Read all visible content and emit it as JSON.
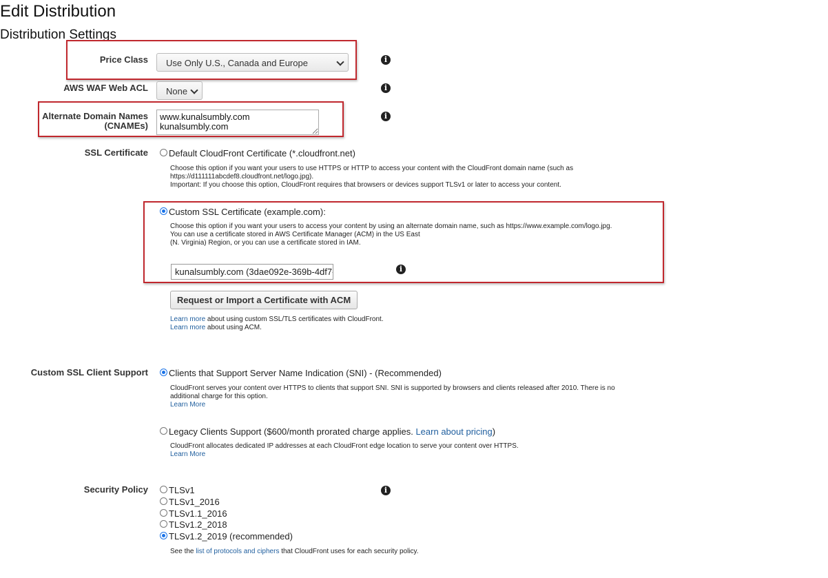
{
  "page": {
    "title": "Edit Distribution",
    "subtitle": "Distribution Settings"
  },
  "price_class": {
    "label": "Price Class",
    "value": "Use Only U.S., Canada and Europe"
  },
  "waf": {
    "label": "AWS WAF Web ACL",
    "value": "None"
  },
  "cnames": {
    "label_line1": "Alternate Domain Names",
    "label_line2": "(CNAMEs)",
    "value": "www.kunalsumbly.com\nkunalsumbly.com"
  },
  "ssl": {
    "label": "SSL Certificate",
    "default_option": "Default CloudFront Certificate (*.cloudfront.net)",
    "default_selected": false,
    "default_desc": [
      "Choose this option if you want your users to use HTTPS or HTTP to access your content with the CloudFront domain name (such as",
      "https://d111111abcdef8.cloudfront.net/logo.jpg).",
      "Important: If you choose this option, CloudFront requires that browsers or devices support TLSv1 or later to access your content."
    ],
    "custom_option": "Custom SSL Certificate (example.com):",
    "custom_selected": true,
    "custom_desc": [
      "Choose this option if you want your users to access your content by using an alternate domain name, such as https://www.example.com/logo.jpg.",
      "You can use a certificate stored in AWS Certificate Manager (ACM) in the US East",
      "(N. Virginia) Region, or you can use a certificate stored in IAM."
    ],
    "certificate_value": "kunalsumbly.com (3dae092e-369b-4df7-",
    "acm_button": "Request or Import a Certificate with ACM",
    "learn_more_1_link": "Learn more",
    "learn_more_1_text": " about using custom SSL/TLS certificates with CloudFront.",
    "learn_more_2_link": "Learn more",
    "learn_more_2_text": " about using ACM."
  },
  "client_support": {
    "label": "Custom SSL Client Support",
    "sni_option": "Clients that Support Server Name Indication (SNI) - (Recommended)",
    "sni_selected": true,
    "sni_desc": [
      "CloudFront serves your content over HTTPS to clients that support SNI. SNI is supported by browsers and clients released after 2010. There is no",
      "additional charge for this option."
    ],
    "sni_learn": "Learn More",
    "legacy_option": "Legacy Clients Support ($600/month prorated charge applies. ",
    "legacy_pricing_link": "Learn about pricing",
    "legacy_close": ")",
    "legacy_selected": false,
    "legacy_desc": "CloudFront allocates dedicated IP addresses at each CloudFront edge location to serve your content over HTTPS.",
    "legacy_learn": "Learn More"
  },
  "security_policy": {
    "label": "Security Policy",
    "options": [
      {
        "label": "TLSv1",
        "selected": false
      },
      {
        "label": "TLSv1_2016",
        "selected": false
      },
      {
        "label": "TLSv1.1_2016",
        "selected": false
      },
      {
        "label": "TLSv1.2_2018",
        "selected": false
      },
      {
        "label": "TLSv1.2_2019 (recommended)",
        "selected": true
      }
    ],
    "see_prefix": "See the ",
    "see_link": "list of protocols and ciphers",
    "see_suffix": " that CloudFront uses for each security policy."
  },
  "colors": {
    "highlight_border": "#c0272d",
    "link": "#1f5e9e",
    "radio_selected": "#1a73e8"
  },
  "icons": {
    "info": "info-icon",
    "dropdown": "chevron-down-icon"
  }
}
